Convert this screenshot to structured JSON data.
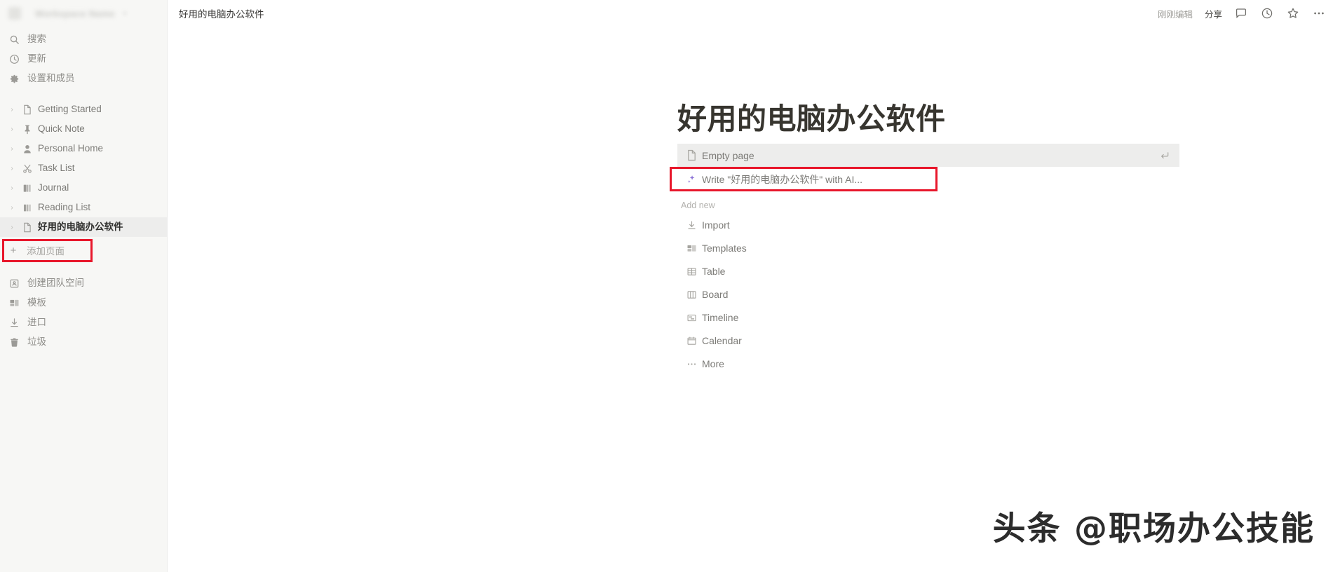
{
  "sidebar": {
    "workspace": {
      "name": "",
      "blurred": true
    },
    "nav": [
      {
        "label": "搜索",
        "icon": "search-icon",
        "name": "sidebar-item-search"
      },
      {
        "label": "更新",
        "icon": "clock-icon",
        "name": "sidebar-item-updates"
      },
      {
        "label": "设置和成员",
        "icon": "gear-icon",
        "name": "sidebar-item-settings-members"
      }
    ],
    "pages": [
      {
        "label": "Getting Started",
        "icon": "document-icon",
        "name": "sidebar-page-getting-started",
        "active": false
      },
      {
        "label": "Quick Note",
        "icon": "pin-icon",
        "name": "sidebar-page-quick-note",
        "active": false
      },
      {
        "label": "Personal Home",
        "icon": "person-icon",
        "name": "sidebar-page-personal-home",
        "active": false
      },
      {
        "label": "Task List",
        "icon": "scissors-icon",
        "name": "sidebar-page-task-list",
        "active": false
      },
      {
        "label": "Journal",
        "icon": "book-icon",
        "name": "sidebar-page-journal",
        "active": false
      },
      {
        "label": "Reading List",
        "icon": "books-icon",
        "name": "sidebar-page-reading-list",
        "active": false
      },
      {
        "label": "好用的电脑办公软件",
        "icon": "document-icon",
        "name": "sidebar-page-current",
        "active": true
      }
    ],
    "add_page": {
      "label": "添加页面",
      "icon": "plus-icon"
    },
    "bottom": [
      {
        "label": "创建团队空间",
        "icon": "teamspace-icon",
        "name": "sidebar-item-create-teamspace"
      },
      {
        "label": "模板",
        "icon": "templates-icon",
        "name": "sidebar-item-templates"
      },
      {
        "label": "进口",
        "icon": "import-icon",
        "name": "sidebar-item-import"
      },
      {
        "label": "垃圾",
        "icon": "trash-icon",
        "name": "sidebar-item-trash"
      }
    ]
  },
  "topbar": {
    "breadcrumb": "好用的电脑办公软件",
    "edited_label": "刚刚编辑",
    "share_label": "分享",
    "icons": [
      {
        "name": "comment-icon"
      },
      {
        "name": "history-clock-icon"
      },
      {
        "name": "star-icon"
      },
      {
        "name": "more-options-icon"
      }
    ]
  },
  "document": {
    "title": "好用的电脑办公软件",
    "empty_page": {
      "label": "Empty page",
      "icon": "document-icon",
      "enter_hint": "enter-return-icon"
    },
    "ai_write": {
      "label": "Write \"好用的电脑办公软件\" with AI...",
      "icon": "ai-sparkle-icon"
    },
    "add_new_header": "Add new",
    "add_new_items": [
      {
        "label": "Import",
        "icon": "import-icon",
        "name": "add-new-import"
      },
      {
        "label": "Templates",
        "icon": "templates-icon",
        "name": "add-new-templates"
      },
      {
        "label": "Table",
        "icon": "table-icon",
        "name": "add-new-table"
      },
      {
        "label": "Board",
        "icon": "board-icon",
        "name": "add-new-board"
      },
      {
        "label": "Timeline",
        "icon": "timeline-icon",
        "name": "add-new-timeline"
      },
      {
        "label": "Calendar",
        "icon": "calendar-icon",
        "name": "add-new-calendar"
      },
      {
        "label": "More",
        "icon": "ellipsis-icon",
        "name": "add-new-more"
      }
    ]
  },
  "annotations": {
    "highlight_color": "#e8172b",
    "boxes": [
      {
        "target": "添加页面",
        "name": "red-highlight-add-page"
      },
      {
        "target": "Write \"好用的电脑办公软件\" with AI...",
        "name": "red-highlight-ai-write"
      }
    ]
  },
  "watermark": {
    "text": "头条 @职场办公技能"
  }
}
